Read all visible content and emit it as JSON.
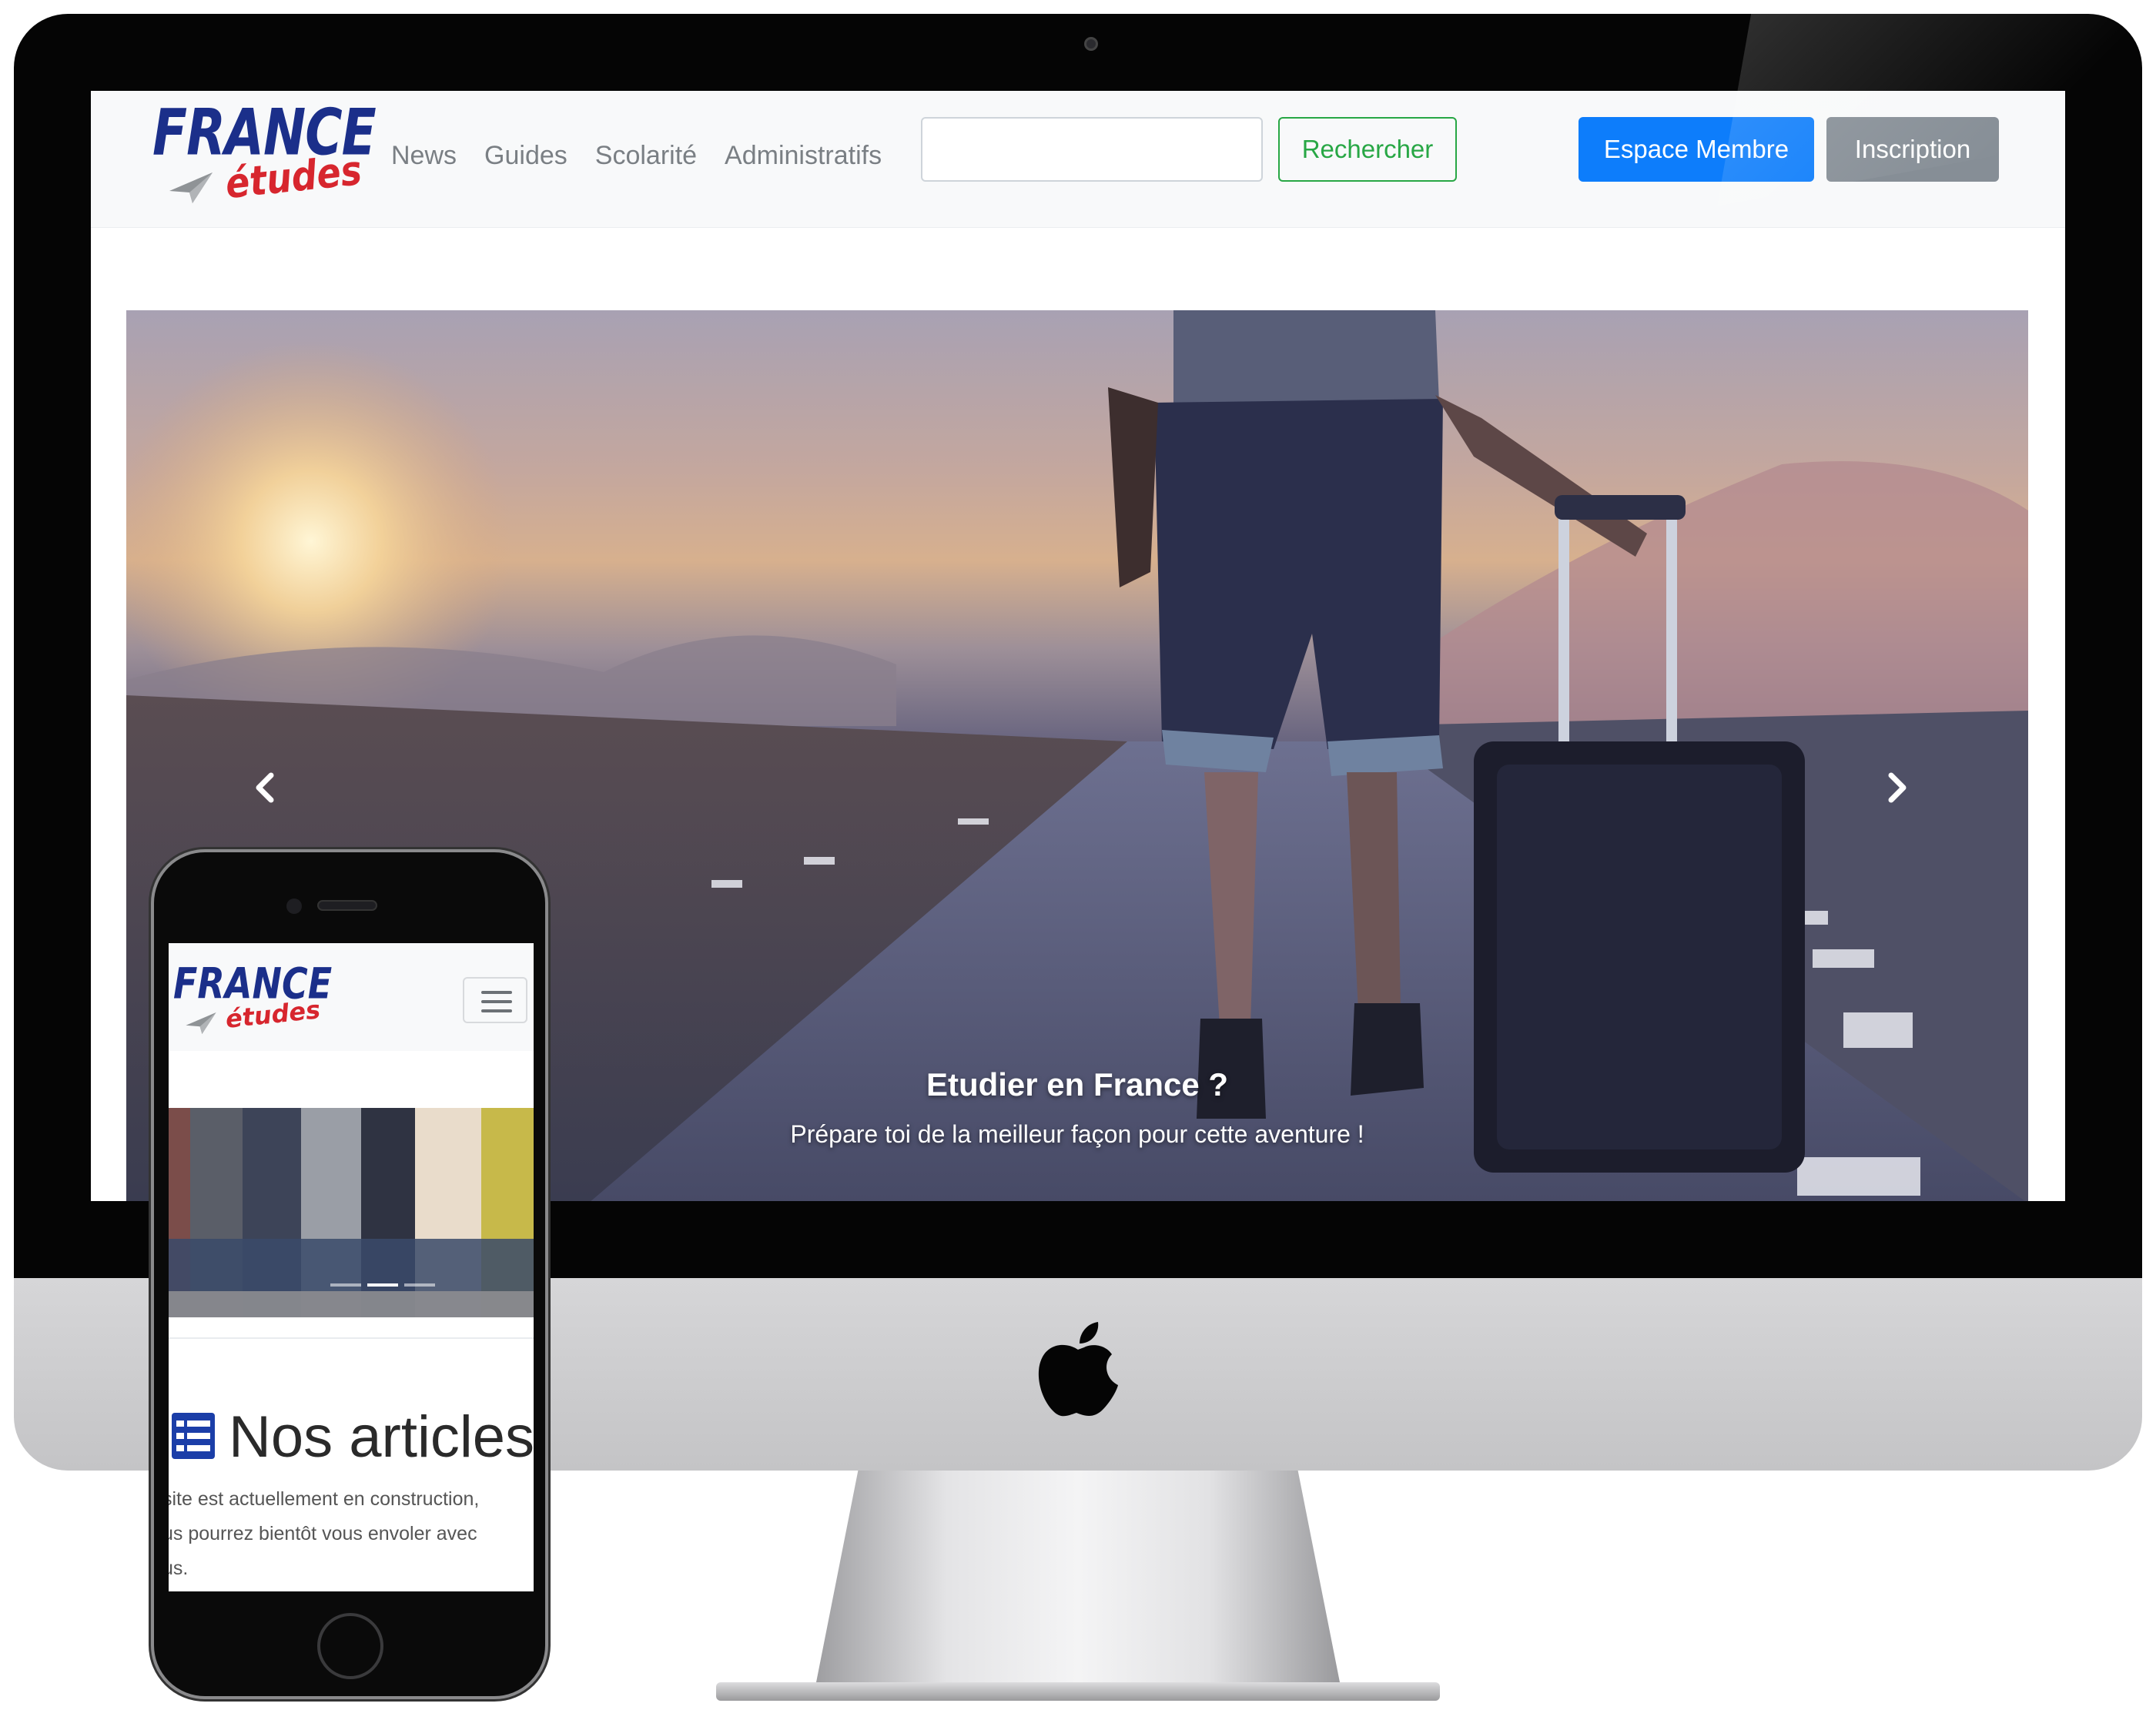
{
  "desktop": {
    "logo": {
      "brand": "FRANCE",
      "sub": "études"
    },
    "nav": {
      "items": [
        {
          "label": "News"
        },
        {
          "label": "Guides"
        },
        {
          "label": "Scolarité"
        },
        {
          "label": "Administratifs"
        }
      ]
    },
    "search": {
      "value": "",
      "button_label": "Rechercher"
    },
    "account": {
      "member_label": "Espace Membre",
      "signup_label": "Inscription"
    },
    "carousel": {
      "caption_title": "Etudier en France ?",
      "caption_text": "Prépare toi de la meilleur façon pour cette aventure !",
      "prev_icon": "chevron-left-icon",
      "next_icon": "chevron-right-icon"
    },
    "colors": {
      "brand_blue": "#1b2f8a",
      "brand_red": "#d7262e",
      "primary": "#0d7dfb",
      "success": "#28a745",
      "secondary": "#868e96"
    }
  },
  "mobile": {
    "logo": {
      "brand": "FRANCE",
      "sub": "études"
    },
    "menu_icon": "hamburger-icon",
    "carousel": {
      "indicator_count": 3,
      "active_index": 1
    },
    "articles": {
      "icon": "list-icon",
      "title": "Nos articles",
      "text_lines": [
        "site est actuellement en construction,",
        "us pourrez bientôt vous envoler avec",
        "us."
      ]
    }
  }
}
